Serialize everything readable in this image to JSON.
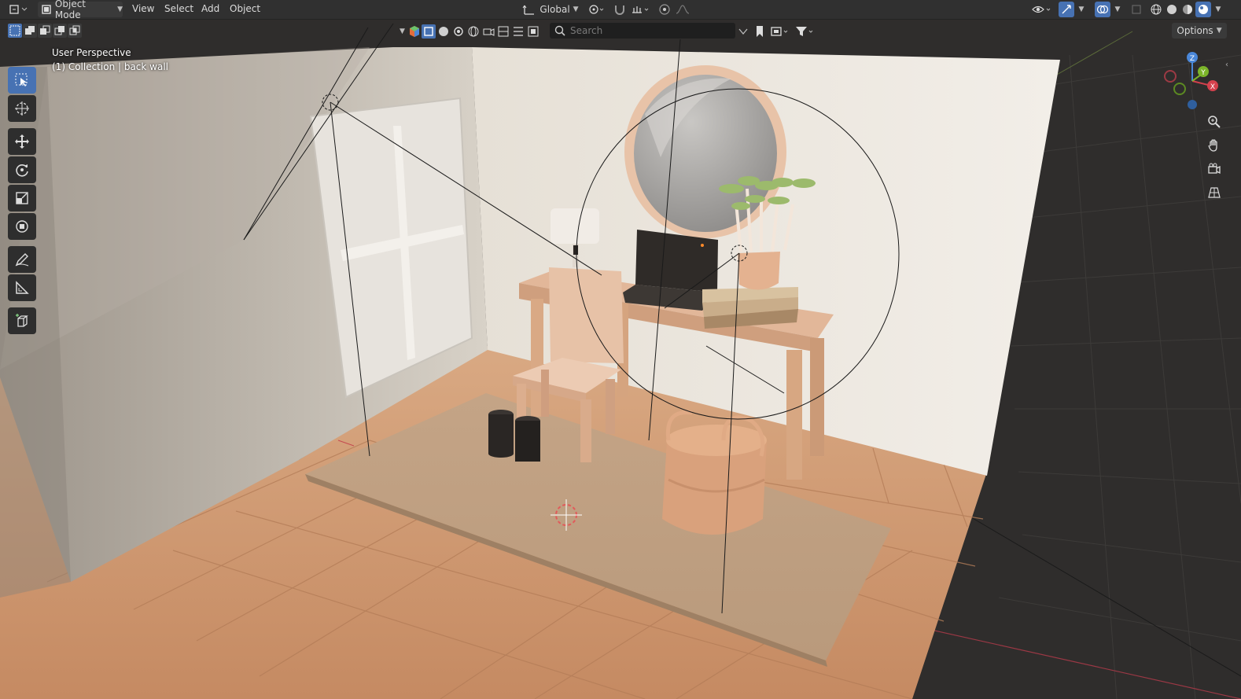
{
  "header": {
    "mode_label": "Object Mode",
    "menus": [
      "View",
      "Select",
      "Add",
      "Object"
    ],
    "transform_orientation": "Global",
    "search_placeholder": "Search",
    "options_label": "Options"
  },
  "viewport": {
    "perspective_label": "User Perspective",
    "collection_label": "(1) Collection | back wall"
  },
  "gizmo": {
    "x": "X",
    "y": "Y",
    "z": "Z"
  },
  "colors": {
    "accent": "#4772b3",
    "wall": "#e8e2d8",
    "floor": "#d8a07a",
    "rug": "#c9ab8d",
    "grid_bg": "#303030"
  },
  "tools": [
    "select-box-icon",
    "cursor-icon",
    "move-icon",
    "rotate-icon",
    "scale-icon",
    "transform-icon",
    "annotate-icon",
    "measure-icon",
    "add-cube-icon"
  ]
}
